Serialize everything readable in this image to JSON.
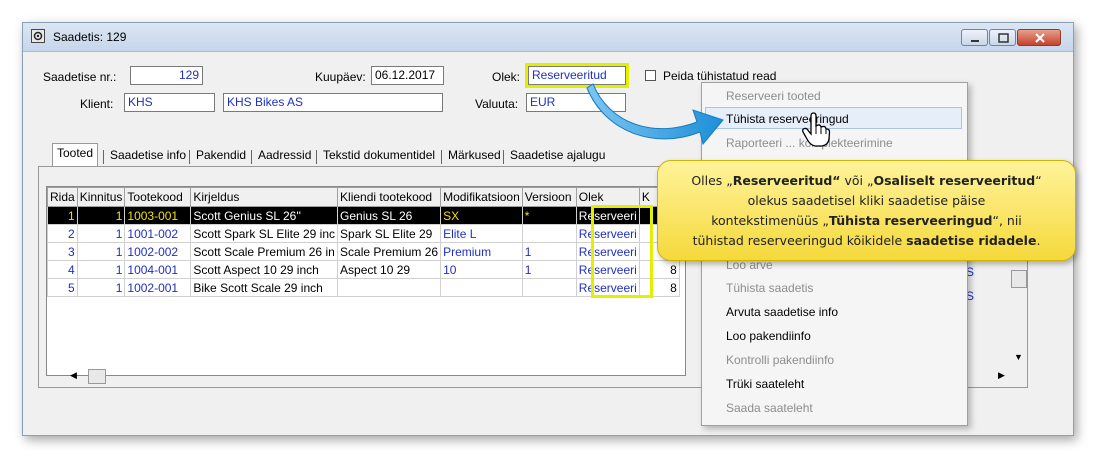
{
  "window": {
    "title": "Saadetis: 129"
  },
  "header": {
    "saadetise_nr_label": "Saadetise nr.:",
    "saadetise_nr_value": "129",
    "kuupaev_label": "Kuupäev:",
    "kuupaev_value": "06.12.2017",
    "olek_label": "Olek:",
    "olek_value": "Reserveeritud",
    "peida_label": "Peida tühistatud read",
    "klient_label": "Klient:",
    "klient_code": "KHS",
    "klient_name": "KHS Bikes AS",
    "valuuta_label": "Valuuta:",
    "valuuta_value": "EUR"
  },
  "tabs": [
    "Tooted",
    "Saadetise info",
    "Pakendid",
    "Aadressid",
    "Tekstid dokumentidel",
    "Märkused",
    "Saadetise ajalugu"
  ],
  "grid": {
    "columns": [
      "Rida",
      "Kinnitus",
      "Tootekood",
      "Kirjeldus",
      "Kliendi tootekood",
      "Modifikatsioon",
      "Versioon",
      "Olek",
      "K"
    ],
    "rows": [
      [
        "1",
        "1",
        "1003-001",
        "Scott Genius SL 26''",
        "Genius SL 26",
        "SX",
        "*",
        "Reserveeri",
        ""
      ],
      [
        "2",
        "1",
        "1001-002",
        "Scott Spark SL Elite 29 inc",
        "Spark SL Elite 29",
        "Elite L",
        "",
        "Reserveeri",
        ""
      ],
      [
        "3",
        "1",
        "1002-002",
        "Scott Scale Premium 26 in",
        "Scale Premium 26",
        "Premium",
        "1",
        "Reserveeri",
        ""
      ],
      [
        "4",
        "1",
        "1004-001",
        "Scott Aspect 10 29 inch",
        "Aspect 10 29",
        "10",
        "1",
        "Reserveeri",
        "8"
      ],
      [
        "5",
        "1",
        "1002-001",
        "Bike Scott Scale 29 inch",
        "",
        "",
        "",
        "Reserveeri",
        "8"
      ]
    ],
    "right_fragments": [
      "S",
      "S"
    ]
  },
  "context_menu": {
    "items": [
      {
        "label": "Reserveeri tooted",
        "disabled": true
      },
      {
        "label": "Tühista reserveeringud",
        "disabled": false,
        "hover": true
      },
      {
        "label": "Raporteeri ... komplekteerimine",
        "disabled": true
      },
      {
        "label": "Loo arve",
        "disabled": true
      },
      {
        "label": "Tühista saadetis",
        "disabled": true
      },
      {
        "label": "Arvuta saadetise info",
        "disabled": false
      },
      {
        "label": "Loo pakendiinfo",
        "disabled": false
      },
      {
        "label": "Kontrolli pakendiinfo",
        "disabled": true
      },
      {
        "label": "Trüki saateleht",
        "disabled": false
      },
      {
        "label": "Saada saateleht",
        "disabled": true
      }
    ]
  },
  "callout": {
    "line1_a": "Olles „",
    "line1_b": "Reserveeritud“",
    "line1_c": " või „",
    "line1_d": "Osaliselt reserveeritud",
    "line1_e": "“",
    "line2": "olekus saadetisel kliki saadetise päise",
    "line3_a": "kontekstimenüüs „",
    "line3_b": "Tühista reserveeringud",
    "line3_c": "“, nii",
    "line4_a": "tühistad reserveeringud kõikidele ",
    "line4_b": "saadetise ridadele",
    "line4_c": "."
  },
  "colors": {
    "highlight": "#e2f000",
    "blue_text": "#1f30c0",
    "callout": "#f5d93b",
    "arrow": "#2a9be0"
  }
}
